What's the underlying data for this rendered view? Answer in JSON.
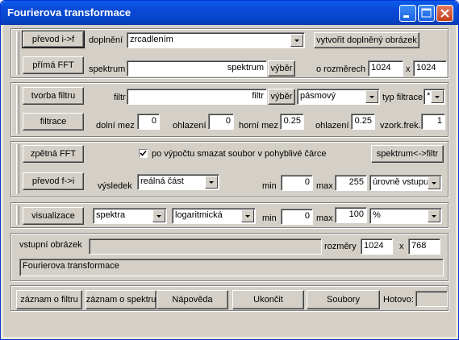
{
  "window": {
    "title": "Fourierova transformace"
  },
  "section1": {
    "prevod_if": "převod i->f",
    "prima_fft": "přímá FFT",
    "doplneni_label": "doplnění",
    "doplneni_value": "zrcadlením",
    "vytvorit_btn": "vytvořit doplněný obrázek",
    "spektrum_label": "spektrum",
    "spektrum_value": "spektrum",
    "vyber": "výběr",
    "o_rozmerech": "o rozměrech",
    "width": "1024",
    "x": "x",
    "height": "1024"
  },
  "section2": {
    "tvorba_filtru": "tvorba filtru",
    "filtrace": "filtrace",
    "filtr_label": "filtr",
    "filtr_value": "filtr",
    "vyber": "výběr",
    "typ_value": "pásmový",
    "typ_filtrace_label": "typ filtrace",
    "typ_filtrace_value": "*",
    "dolni_mez_label": "dolní mez",
    "dolni_mez": "0",
    "ohlazeni1_label": "ohlazení",
    "ohlazeni1": "0",
    "horni_mez_label": "horní mez",
    "horni_mez": "0.25",
    "ohlazeni2_label": "ohlazení",
    "ohlazeni2": "0.25",
    "vzork_label": "vzork.frek.",
    "vzork": "1"
  },
  "section3": {
    "zpetna_fft": "zpětná FFT",
    "prevod_fi": "převod f->i",
    "checkbox_label": "po výpočtu smazat soubor v pohyblivé čárce",
    "checkbox_checked": true,
    "spektrum_filtr": "spektrum<->filtr",
    "vysledek_label": "výsledek",
    "vysledek_value": "reálná část",
    "min_label": "min",
    "min": "0",
    "max_label": "max",
    "max": "255",
    "uroven_value": "úrovně vstupu"
  },
  "section4": {
    "vizualizace": "visualizace",
    "spektra_value": "spektra",
    "scale_value": "logaritmická",
    "min_label": "min",
    "min": "0",
    "max_label": "max",
    "max": "100",
    "unit_value": "%"
  },
  "section5": {
    "vstupni_label": "vstupní obrázek",
    "vstupni_value": "",
    "rozmery_label": "rozměry",
    "width": "1024",
    "x": "x",
    "height": "768",
    "status": "Fourierova transformace"
  },
  "bottom": {
    "zaznam_filtru": "záznam o filtru",
    "zaznam_spektru": "záznam o spektru",
    "napoveda": "Nápověda",
    "ukoncit": "Ukončit",
    "soubory": "Soubory",
    "hotovo_label": "Hotovo:",
    "hotovo_value": ""
  }
}
